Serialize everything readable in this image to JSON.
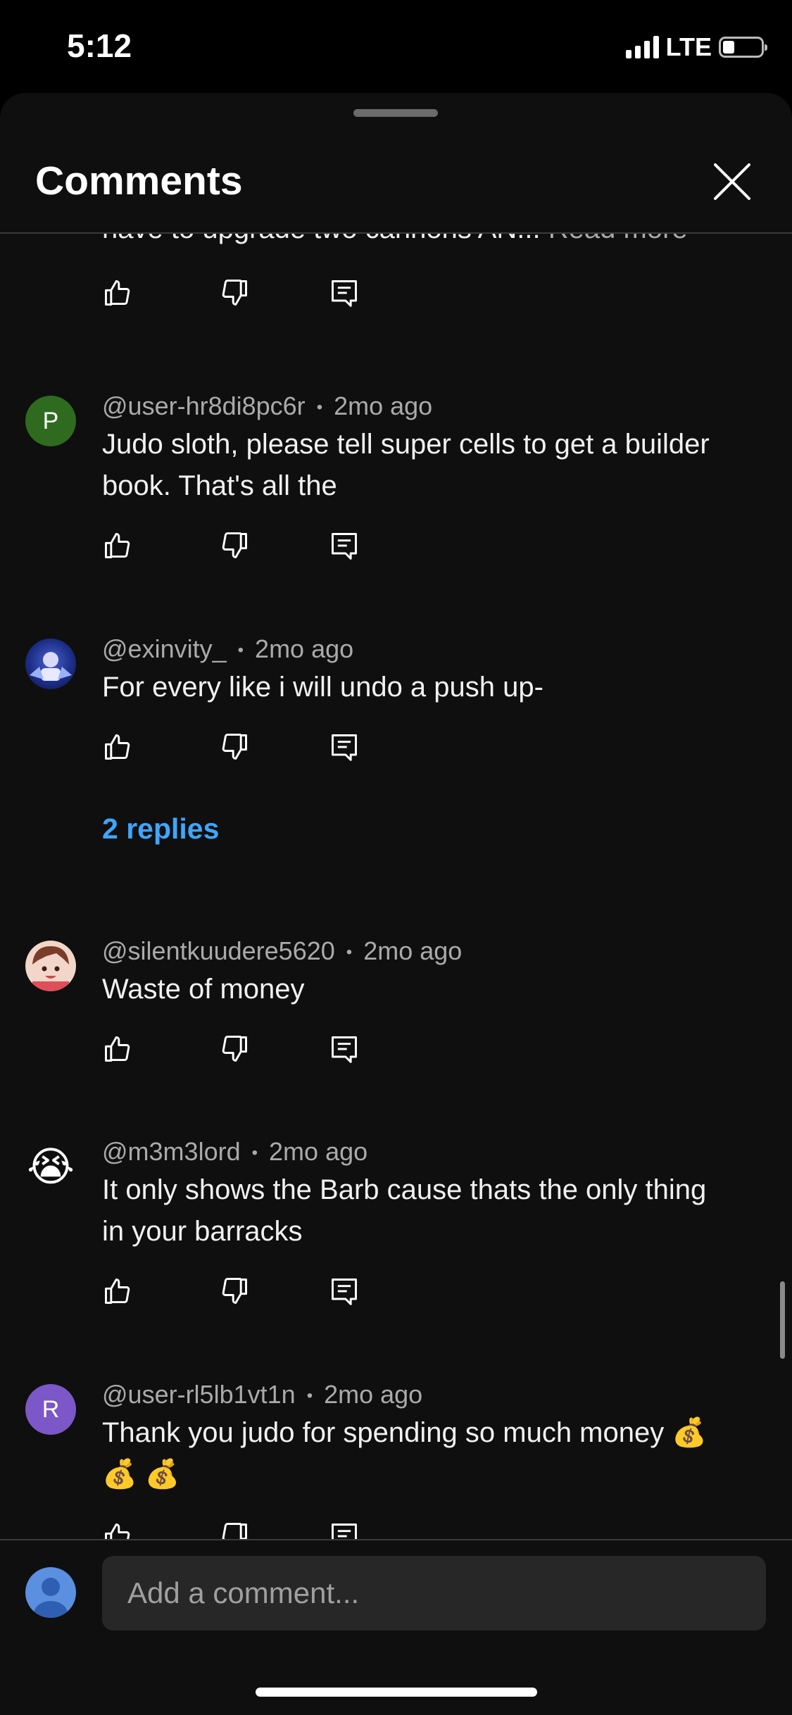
{
  "status_bar": {
    "time": "5:12",
    "network": "LTE"
  },
  "header": {
    "title": "Comments"
  },
  "partial_comment": {
    "text": "have to upgrade two cannons AN...",
    "read_more": "Read more"
  },
  "comments": [
    {
      "initial": "P",
      "avatar_color": "#2e6b1f",
      "author": "@user-hr8di8pc6r",
      "time": "2mo ago",
      "text": "Judo sloth, please tell super cells to get a builder book. That's all the"
    },
    {
      "initial": "",
      "avatar_color": "#1c2f8a",
      "author": "@exinvity_",
      "time": "2mo ago",
      "text": "For every like i will undo a push up-",
      "replies": "2 replies"
    },
    {
      "initial": "",
      "avatar_color": "#f2d6c9",
      "author": "@silentkuudere5620",
      "time": "2mo ago",
      "text": "Waste of money"
    },
    {
      "initial": "😭",
      "avatar_color": "#0f0f0f",
      "author": "@m3m3lord",
      "time": "2mo ago",
      "text": "It only shows the Barb cause thats the only thing in your barracks"
    },
    {
      "initial": "R",
      "avatar_color": "#7b57c8",
      "author": "@user-rl5lb1vt1n",
      "time": "2mo ago",
      "text": "Thank you judo for spending so much money 💰 💰 💰"
    }
  ],
  "meta_separator": "•",
  "composer": {
    "placeholder": "Add a comment..."
  },
  "colors": {
    "background": "#0f0f0f",
    "link": "#3ea6ff",
    "secondary_text": "#aaaaaa"
  }
}
